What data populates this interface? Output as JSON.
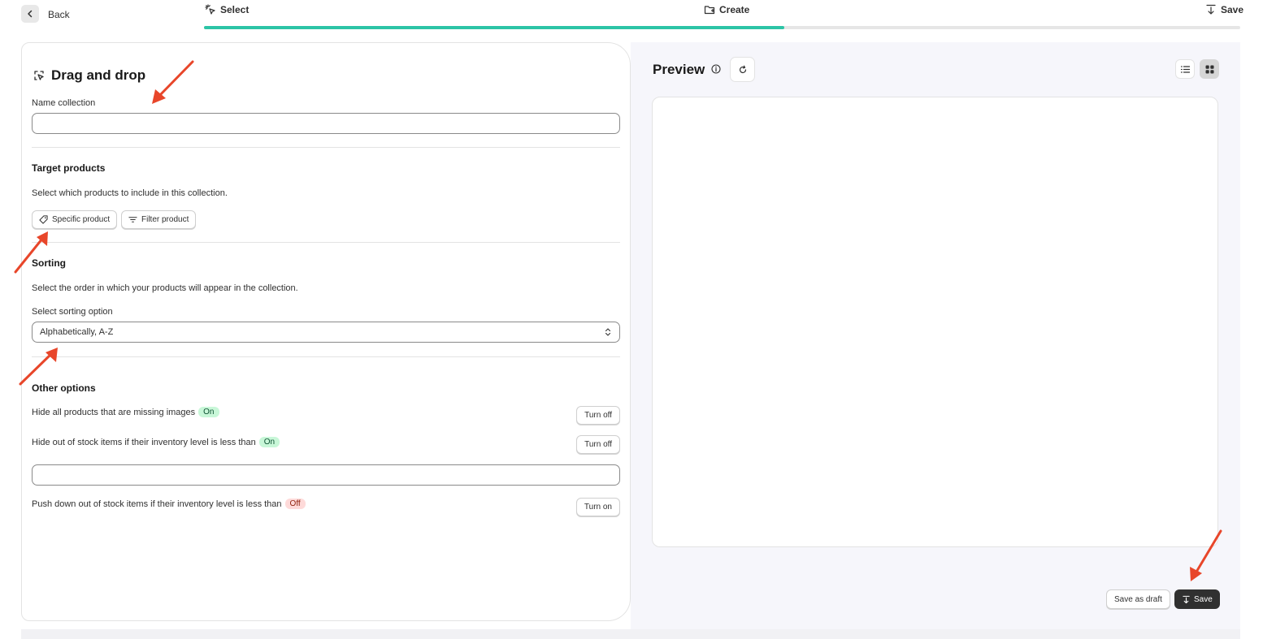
{
  "topbar": {
    "back_label": "Back",
    "steps": [
      {
        "label": "Select",
        "icon": "cursor-click-icon"
      },
      {
        "label": "Create",
        "icon": "folder-plus-icon"
      },
      {
        "label": "Save",
        "icon": "download-icon"
      }
    ],
    "progress_fraction": 0.56,
    "progress_color": "#2cc4a6"
  },
  "form": {
    "title": "Drag and drop",
    "name_label": "Name collection",
    "name_value": "",
    "target": {
      "title": "Target products",
      "description": "Select which products to include in this collection.",
      "specific_label": "Specific product",
      "filter_label": "Filter product"
    },
    "sorting": {
      "title": "Sorting",
      "description": "Select the order in which your products will appear in the collection.",
      "select_label": "Select sorting option",
      "selected": "Alphabetically, A-Z"
    },
    "other": {
      "title": "Other options",
      "missing_images": {
        "text": "Hide all products that are missing images",
        "status": "On",
        "action": "Turn off"
      },
      "out_of_stock": {
        "text": "Hide out of stock items if their inventory level is less than",
        "status": "On",
        "action": "Turn off",
        "value": ""
      },
      "push_down": {
        "text": "Push down out of stock items if their inventory level is less than",
        "status": "Off",
        "action": "Turn on"
      }
    }
  },
  "preview": {
    "title": "Preview",
    "save_draft_label": "Save as draft",
    "save_label": "Save"
  },
  "colors": {
    "badge_on_bg": "#c8f7d8",
    "badge_off_bg": "#fedad9",
    "annotation_arrow": "#e8462a",
    "primary_button": "#303030"
  }
}
